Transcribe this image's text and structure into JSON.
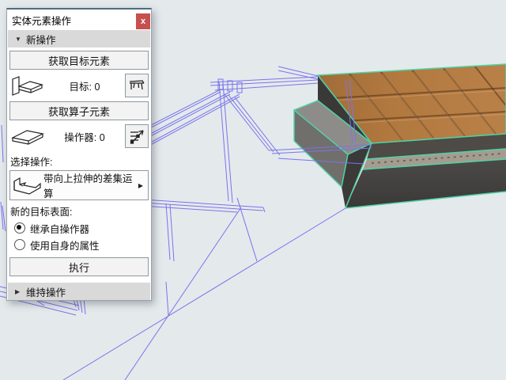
{
  "window": {
    "title": "实体元素操作",
    "close_label": "x"
  },
  "panel": {
    "sections": {
      "new_operation": {
        "label": "新操作",
        "expanded": true
      },
      "keep_operation": {
        "label": "维持操作",
        "expanded": false
      }
    },
    "get_target_button": "获取目标元素",
    "target_row": {
      "label": "目标:",
      "count": "0"
    },
    "get_operator_button": "获取算子元素",
    "operator_row": {
      "label": "操作器:",
      "count": "0"
    },
    "select_operation_label": "选择操作:",
    "operation_dropdown": {
      "value": "带向上拉伸的差集运算"
    },
    "new_target_surface_label": "新的目标表面:",
    "radio_options": [
      {
        "label": "继承自操作器",
        "selected": true
      },
      {
        "label": "使用自身的属性",
        "selected": false
      }
    ],
    "execute_button": "执行"
  },
  "icons": {
    "triangle_down": "▼",
    "triangle_right": "▶",
    "dropdown_arrow": "▶"
  },
  "colors": {
    "viewport_background": "#e4e9ec",
    "wireframe": "#7b73eb",
    "selection_edge": "#4fd3a8",
    "tile_top": "#b2793f",
    "close_button": "#c7504e",
    "panel_accent": "#4e6d7d"
  }
}
